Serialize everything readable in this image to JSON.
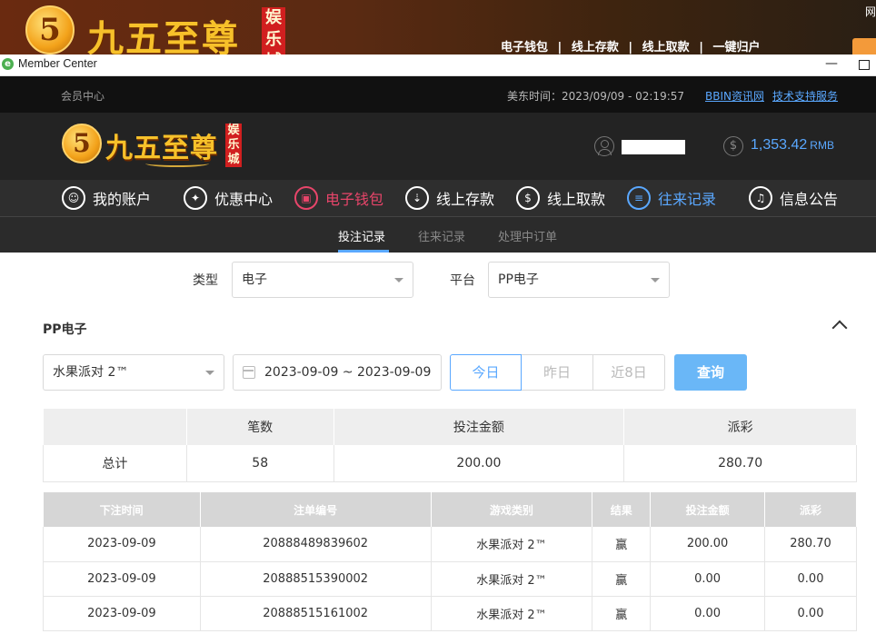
{
  "background_site": {
    "logo_glyph": "5",
    "logo_text": "九五至尊",
    "logo_tag": "娱乐城",
    "nav": [
      "电子钱包",
      "线上存款",
      "线上取款",
      "一键归户"
    ],
    "nav_separator": "|",
    "corner_text": "网"
  },
  "window": {
    "app_icon": "e",
    "title": "Member Center",
    "min_glyph": "—"
  },
  "topbar": {
    "label": "会员中心",
    "time": "美东时间：2023/09/09 - 02:19:57",
    "links": [
      "BBIN资讯网",
      "技术支持服务"
    ]
  },
  "header": {
    "logo_glyph": "5",
    "logo_text": "九五至尊",
    "logo_tag": "娱乐城",
    "coin_glyph": "$",
    "balance": "1,353.42",
    "currency": "RMB"
  },
  "main_nav": [
    {
      "label": "我的账户",
      "icon": "user-icon",
      "glyph": "☺"
    },
    {
      "label": "优惠中心",
      "icon": "gift-icon",
      "glyph": "✦"
    },
    {
      "label": "电子钱包",
      "icon": "wallet-icon",
      "glyph": "▣"
    },
    {
      "label": "线上存款",
      "icon": "deposit-icon",
      "glyph": "⇣"
    },
    {
      "label": "线上取款",
      "icon": "withdraw-icon",
      "glyph": "$"
    },
    {
      "label": "往来记录",
      "icon": "records-icon",
      "glyph": "≡"
    },
    {
      "label": "信息公告",
      "icon": "bell-icon",
      "glyph": "♫"
    }
  ],
  "sub_tabs": [
    "投注记录",
    "往来记录",
    "处理中订单"
  ],
  "filters": {
    "type_label": "类型",
    "type_value": "电子",
    "platform_label": "平台",
    "platform_value": "PP电子"
  },
  "section_title": "PP电子",
  "query": {
    "game_value": "水果派对 2™",
    "date_range": "2023-09-09 ~ 2023-09-09",
    "buttons": [
      "今日",
      "昨日",
      "近8日"
    ],
    "submit": "查询"
  },
  "summary": {
    "headers": [
      "",
      "笔数",
      "投注金额",
      "派彩"
    ],
    "row": [
      "总计",
      "58",
      "200.00",
      "280.70"
    ]
  },
  "records": {
    "headers": [
      "下注时间",
      "注单编号",
      "游戏类别",
      "结果",
      "投注金额",
      "派彩"
    ],
    "rows": [
      [
        "2023-09-09",
        "20888489839602",
        "水果派对 2™",
        "赢",
        "200.00",
        "280.70"
      ],
      [
        "2023-09-09",
        "20888515390002",
        "水果派对 2™",
        "赢",
        "0.00",
        "0.00"
      ],
      [
        "2023-09-09",
        "20888515161002",
        "水果派对 2™",
        "赢",
        "0.00",
        "0.00"
      ]
    ]
  },
  "colors": {
    "accent_blue": "#5aa8ff",
    "active_red": "#e8456a",
    "gold": "#f7c12a"
  }
}
